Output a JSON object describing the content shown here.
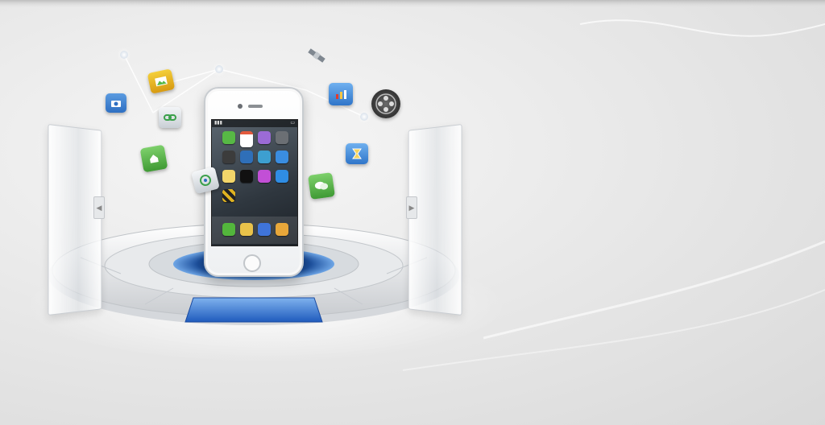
{
  "banner": {
    "device": "smartphone",
    "colors": {
      "background": "#e6e6e6",
      "accent_blue": "#2f6fd6",
      "screen_dark": "#2f373f"
    },
    "floating_icons": [
      {
        "name": "camera-app-icon",
        "color": "#3b7cc9"
      },
      {
        "name": "photo-album-icon",
        "color": "#e7b317"
      },
      {
        "name": "chain-link-icon",
        "color": "#d8dde2"
      },
      {
        "name": "bookmark-app-icon",
        "color": "#58b248"
      },
      {
        "name": "satellite-icon",
        "color": "#9aa0a6"
      },
      {
        "name": "chart-app-icon",
        "color": "#3f8bd8"
      },
      {
        "name": "film-reel-icon",
        "color": "#4a4a4a"
      },
      {
        "name": "hourglass-app-icon",
        "color": "#3b89d4"
      },
      {
        "name": "chat-app-icon",
        "color": "#4cae3e"
      },
      {
        "name": "camera-circle-icon",
        "color": "#5f9fe0"
      }
    ],
    "screen_icons": [
      {
        "name": "messages-app-icon",
        "color": "#57b845"
      },
      {
        "name": "calendar-app-icon",
        "color": "#e35a3d"
      },
      {
        "name": "photos-app-icon",
        "color": "#9b6bd6"
      },
      {
        "name": "camera-app-icon",
        "color": "#6b6f74"
      },
      {
        "name": "videos-app-icon",
        "color": "#3c3c3c"
      },
      {
        "name": "stocks-app-icon",
        "color": "#2f6fb8"
      },
      {
        "name": "maps-app-icon",
        "color": "#3d9fd0"
      },
      {
        "name": "weather-app-icon",
        "color": "#3a8de0"
      },
      {
        "name": "notes-app-icon",
        "color": "#f3d66a"
      },
      {
        "name": "clock-app-icon",
        "color": "#111111"
      },
      {
        "name": "itunes-app-icon",
        "color": "#c24fd6"
      },
      {
        "name": "appstore-app-icon",
        "color": "#2f8de4"
      },
      {
        "name": "settings-app-icon",
        "color": "#e0b320"
      },
      {
        "name": "phone-app-icon",
        "color": "#53b63c"
      },
      {
        "name": "mail-app-icon",
        "color": "#e9c24a"
      },
      {
        "name": "safari-app-icon",
        "color": "#3f74d9"
      },
      {
        "name": "ipod-app-icon",
        "color": "#e8a73a"
      }
    ]
  }
}
